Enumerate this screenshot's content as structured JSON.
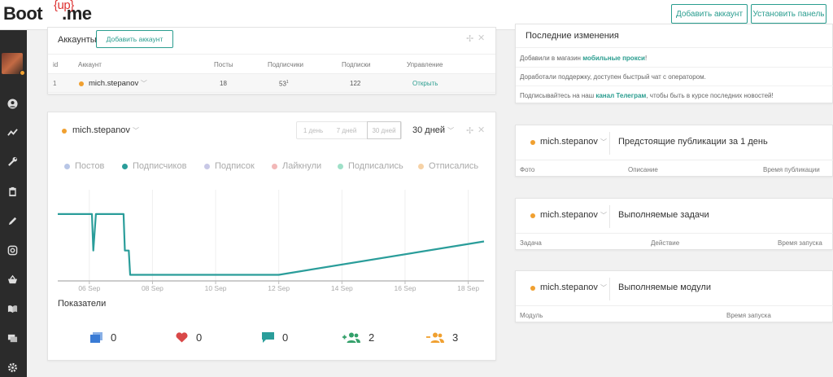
{
  "header": {
    "logo_main": "Boot",
    "logo_up": "{up}",
    "logo_me": ".me",
    "add_account_btn": "Добавить аккаунт",
    "install_panel_btn": "Установить панель"
  },
  "accounts": {
    "title": "Аккаунты",
    "add_btn": "Добавить аккаунт",
    "columns": [
      "id",
      "Аккаунт",
      "Посты",
      "Подписчики",
      "Подписки",
      "Управление"
    ],
    "row": {
      "id": "1",
      "name": "mich.stepanov",
      "posts": "18",
      "followers": "53",
      "followers_sup": "1",
      "following": "122",
      "action": "Открыть"
    }
  },
  "stats": {
    "account": "mich.stepanov",
    "periods": [
      "1 день",
      "7 дней",
      "30 дней"
    ],
    "period_select": "30 дней",
    "legend": [
      {
        "label": "Постов",
        "color": "#b8c6e6"
      },
      {
        "label": "Подписчиков",
        "color": "#2a9d9a"
      },
      {
        "label": "Подписок",
        "color": "#c8c8e6"
      },
      {
        "label": "Лайкнули",
        "color": "#f2b8b8"
      },
      {
        "label": "Подписались",
        "color": "#9fe0c8"
      },
      {
        "label": "Отписались",
        "color": "#f6d2a6"
      }
    ],
    "indicators_title": "Показатели",
    "indicators": [
      {
        "icon": "images-icon",
        "value": "0",
        "color": "#3a7bd5"
      },
      {
        "icon": "heart-icon",
        "value": "0",
        "color": "#d94848"
      },
      {
        "icon": "comment-icon",
        "value": "0",
        "color": "#2a9d9a"
      },
      {
        "icon": "user-add-icon",
        "value": "2",
        "color": "#33a06a"
      },
      {
        "icon": "user-remove-icon",
        "value": "3",
        "color": "#f0a030"
      }
    ]
  },
  "chart_data": {
    "type": "line",
    "x_ticks": [
      "06 Sep",
      "08 Sep",
      "10 Sep",
      "12 Sep",
      "14 Sep",
      "16 Sep",
      "18 Sep"
    ],
    "series": [
      {
        "name": "Подписчиков",
        "color": "#2a9d9a",
        "points": [
          {
            "x": "05 Sep",
            "y": 54
          },
          {
            "x": "05 Sep 20:00",
            "y": 54
          },
          {
            "x": "06 Sep 02:00",
            "y": 54
          },
          {
            "x": "06 Sep 03:00",
            "y": 53.4
          },
          {
            "x": "06 Sep 05:00",
            "y": 54
          },
          {
            "x": "07 Sep 02:00",
            "y": 54
          },
          {
            "x": "07 Sep 03:00",
            "y": 53.4
          },
          {
            "x": "07 Sep 06:00",
            "y": 53.4
          },
          {
            "x": "07 Sep 07:00",
            "y": 53
          },
          {
            "x": "07 Sep 12:00",
            "y": 53
          },
          {
            "x": "12 Sep",
            "y": 53
          },
          {
            "x": "18 Sep 12:00",
            "y": 53.55
          }
        ]
      }
    ],
    "grid": true
  },
  "changes": {
    "title": "Последние изменения",
    "items": [
      {
        "text": "Добавили в магазин ",
        "link": "мобильные прокси",
        "tail": "!"
      },
      {
        "text": "Доработали поддержку, доступен быстрый чат с оператором.",
        "link": "",
        "tail": ""
      },
      {
        "text": "Подписывайтесь на наш ",
        "link": "канал Телеграм",
        "tail": ", чтобы быть в курсе последних новостей!"
      }
    ]
  },
  "upcoming": {
    "account": "mich.stepanov",
    "title": "Предстоящие публикации за 1 день",
    "columns": [
      "Фото",
      "Описание",
      "Время публикации"
    ]
  },
  "tasks": {
    "account": "mich.stepanov",
    "title": "Выполняемые задачи",
    "columns": [
      "Задача",
      "Действие",
      "Время запуска"
    ]
  },
  "modules": {
    "account": "mich.stepanov",
    "title": "Выполняемые модули",
    "columns": [
      "Модуль",
      "Время запуска"
    ]
  }
}
